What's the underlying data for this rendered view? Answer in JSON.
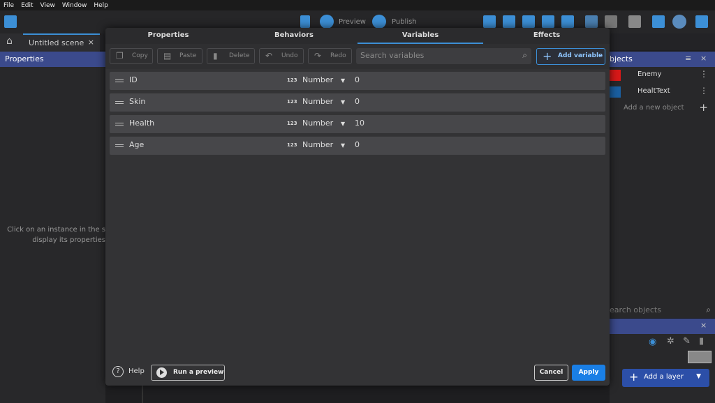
{
  "menu": [
    "File",
    "Edit",
    "View",
    "Window",
    "Help"
  ],
  "toolbar": {
    "preview_label": "Preview",
    "publish_label": "Publish"
  },
  "scene_tab": {
    "label": "Untitled scene",
    "close": "×"
  },
  "properties_panel": {
    "title": "Properties",
    "hint_line1": "Click on an instance in the s",
    "hint_line2": "display its properties"
  },
  "objects_panel": {
    "title": "bjects",
    "items": [
      {
        "name": "Enemy",
        "thumb_color": "#d81818"
      },
      {
        "name": "HealtText",
        "thumb_color": "#1a5fa0"
      }
    ],
    "add_new": "Add a new object",
    "search_placeholder": "earch objects"
  },
  "layers_panel": {
    "add_layer_label": "Add a layer"
  },
  "dialog": {
    "tabs": [
      "Properties",
      "Behaviors",
      "Variables",
      "Effects"
    ],
    "active_tab": "Variables",
    "toolbar": {
      "copy": "Copy",
      "paste": "Paste",
      "delete": "Delete",
      "undo": "Undo",
      "redo": "Redo",
      "search_placeholder": "Search variables",
      "add_variable": "Add variable"
    },
    "variables": [
      {
        "name": "ID",
        "type_icon": "123",
        "type": "Number",
        "value": "0"
      },
      {
        "name": "Skin",
        "type_icon": "123",
        "type": "Number",
        "value": "0"
      },
      {
        "name": "Health",
        "type_icon": "123",
        "type": "Number",
        "value": "10"
      },
      {
        "name": "Age",
        "type_icon": "123",
        "type": "Number",
        "value": "0"
      }
    ],
    "footer": {
      "help": "Help",
      "run_preview": "Run a preview",
      "cancel": "Cancel",
      "apply": "Apply"
    }
  }
}
